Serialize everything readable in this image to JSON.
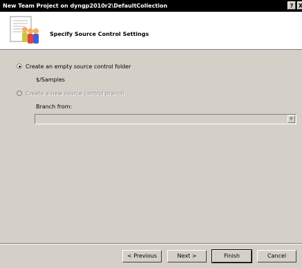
{
  "window": {
    "title": "New Team Project on dyngp2010r2\\DefaultCollection",
    "help_label": "?",
    "close_label": "X"
  },
  "header": {
    "title": "Specify Source Control Settings",
    "icon": "team-project-wizard-icon"
  },
  "options": {
    "empty_folder": {
      "label": "Create an empty source control folder",
      "selected": true,
      "path": "$/Samples"
    },
    "new_branch": {
      "label": "Create a new source control branch",
      "selected": false,
      "enabled": false,
      "branch_from_label": "Branch from:",
      "branch_from_value": ""
    }
  },
  "buttons": {
    "previous": "< Previous",
    "next": "Next >",
    "finish": "Finish",
    "cancel": "Cancel"
  }
}
